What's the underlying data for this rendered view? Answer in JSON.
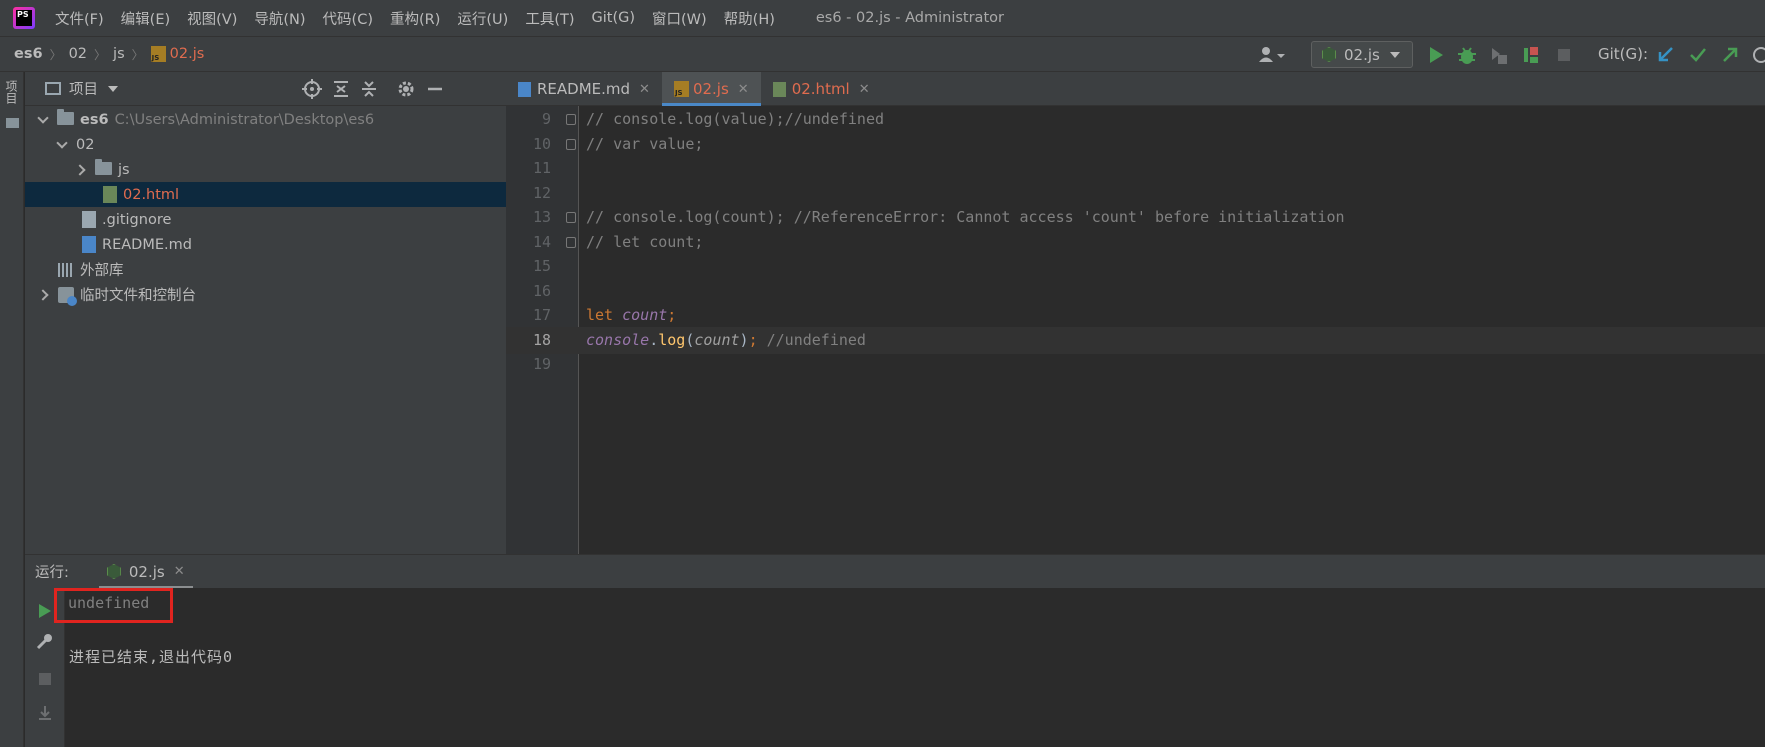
{
  "menubar": {
    "logo": "PS",
    "items": [
      "文件(F)",
      "编辑(E)",
      "视图(V)",
      "导航(N)",
      "代码(C)",
      "重构(R)",
      "运行(U)",
      "工具(T)",
      "Git(G)",
      "窗口(W)",
      "帮助(H)"
    ],
    "window_title": "es6 - 02.js - Administrator"
  },
  "navbar": {
    "breadcrumb": [
      "es6",
      "02",
      "js",
      "02.js"
    ],
    "run_config": "02.js",
    "git_label": "Git(G):",
    "icons": [
      "user-caret-icon",
      "run-icon",
      "debug-icon",
      "coverage-icon",
      "profile-icon",
      "stop-icon",
      "git-update-icon",
      "git-commit-icon",
      "git-push-icon",
      "history-icon"
    ]
  },
  "left_strip": {
    "label": "项目"
  },
  "project": {
    "title": "项目",
    "header_icons": [
      "locate-icon",
      "expand-all-icon",
      "collapse-all-icon",
      "settings-icon",
      "hide-icon"
    ],
    "tree": [
      {
        "name": "es6",
        "path": "C:\\Users\\Administrator\\Desktop\\es6"
      },
      {
        "name": "02"
      },
      {
        "name": "js"
      },
      {
        "name": "02.html"
      },
      {
        "name": ".gitignore"
      },
      {
        "name": "README.md"
      },
      {
        "name": "外部库"
      },
      {
        "name": "临时文件和控制台"
      }
    ]
  },
  "editor": {
    "tabs": [
      {
        "label": "README.md",
        "type": "md",
        "active": false
      },
      {
        "label": "02.js",
        "type": "js",
        "active": true
      },
      {
        "label": "02.html",
        "type": "html",
        "active": false
      }
    ],
    "current_line": 18,
    "lines": [
      {
        "num": "9",
        "fold": true,
        "tokens": [
          {
            "c": "cm",
            "t": "// console.log(value);//undefined"
          }
        ]
      },
      {
        "num": "10",
        "fold": true,
        "tokens": [
          {
            "c": "cm",
            "t": "// var value;"
          }
        ]
      },
      {
        "num": "11",
        "fold": false,
        "tokens": []
      },
      {
        "num": "12",
        "fold": false,
        "tokens": []
      },
      {
        "num": "13",
        "fold": true,
        "tokens": [
          {
            "c": "cm",
            "t": "// console.log(count); //ReferenceError: Cannot access 'count' before initialization"
          }
        ]
      },
      {
        "num": "14",
        "fold": true,
        "tokens": [
          {
            "c": "cm",
            "t": "// let count;"
          }
        ]
      },
      {
        "num": "15",
        "fold": false,
        "tokens": []
      },
      {
        "num": "16",
        "fold": false,
        "tokens": []
      },
      {
        "num": "17",
        "fold": false,
        "tokens": [
          {
            "c": "kw",
            "t": "let "
          },
          {
            "c": "gvar",
            "t": "count"
          },
          {
            "c": "kw",
            "t": ";"
          }
        ]
      },
      {
        "num": "18",
        "fold": false,
        "tokens": [
          {
            "c": "gvar",
            "t": "console"
          },
          {
            "c": "plain",
            "t": "."
          },
          {
            "c": "fn",
            "t": "log"
          },
          {
            "c": "plain",
            "t": "("
          },
          {
            "c": "lvar",
            "t": "count"
          },
          {
            "c": "plain",
            "t": ")"
          },
          {
            "c": "kw",
            "t": "; "
          },
          {
            "c": "cm",
            "t": "//undefined"
          }
        ]
      },
      {
        "num": "19",
        "fold": false,
        "tokens": []
      }
    ]
  },
  "run": {
    "label": "运行:",
    "tab_label": "02.js",
    "output": [
      "undefined",
      "进程已结束,退出代码0"
    ],
    "toolbar_icons": [
      "rerun-icon",
      "wrench-icon",
      "stop-icon",
      "scroll-to-end-icon"
    ]
  },
  "colors": {
    "accent": "#4a88c7",
    "run_green": "#499c54",
    "highlight_red": "#e0241f",
    "selected_row": "#0d293e"
  }
}
